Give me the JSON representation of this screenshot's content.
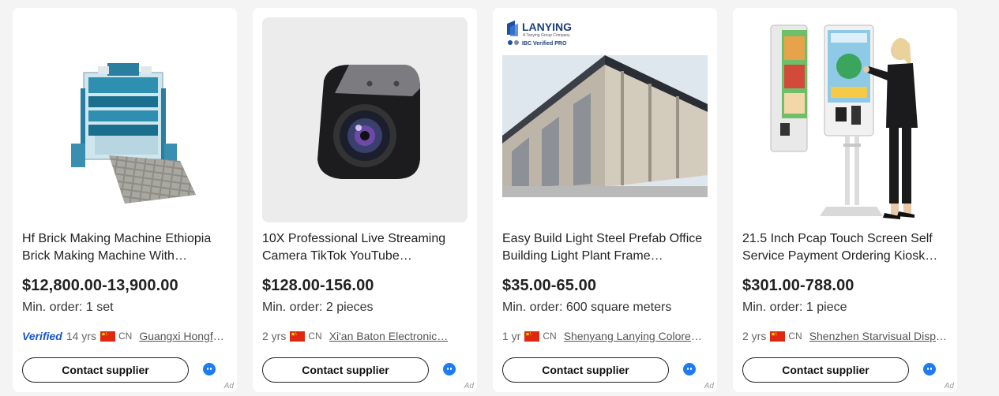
{
  "products": [
    {
      "image_name": "brick-making-machine-image",
      "title": "Hf Brick Making Machine Ethiopia Brick Making Machine With…",
      "price": "$12,800.00-13,900.00",
      "moq": "Min. order: 1 set",
      "verified": true,
      "verified_label": "Verified",
      "years": "14 yrs",
      "country": "CN",
      "supplier": "Guangxi Hongfa…",
      "contact_label": "Contact supplier",
      "ad_label": "Ad"
    },
    {
      "image_name": "streaming-camera-image",
      "title": "10X Professional Live Streaming Camera TikTok YouTube Facebook…",
      "price": "$128.00-156.00",
      "moq": "Min. order: 2 pieces",
      "verified": false,
      "years": "2 yrs",
      "country": "CN",
      "supplier": "Xi'an Baton Electronic…",
      "contact_label": "Contact supplier",
      "ad_label": "Ad"
    },
    {
      "image_name": "steel-prefab-building-image",
      "image_text": {
        "brand": "LANYING",
        "sub": "A Tanying Group Company",
        "badge": "IBC Verified PRO"
      },
      "title": "Easy Build Light Steel Prefab Office Building Light Plant Frame…",
      "price": "$35.00-65.00",
      "moq": "Min. order: 600 square meters",
      "verified": false,
      "years": "1 yr",
      "country": "CN",
      "supplier": "Shenyang Lanying Colored…",
      "contact_label": "Contact supplier",
      "ad_label": "Ad"
    },
    {
      "image_name": "payment-kiosk-image",
      "title": "21.5 Inch Pcap Touch Screen Self Service Payment Ordering Kiosk fo…",
      "price": "$301.00-788.00",
      "moq": "Min. order: 1 piece",
      "verified": false,
      "years": "2 yrs",
      "country": "CN",
      "supplier": "Shenzhen Starvisual Displa…",
      "contact_label": "Contact supplier",
      "ad_label": "Ad"
    }
  ],
  "colors": {
    "verified_blue": "#1a56c8",
    "chat_blue": "#1e7bf3",
    "cn_flag_red": "#de2910",
    "cn_flag_star": "#ffde00"
  },
  "icons": {
    "chat": "chat-bubble-icon",
    "flag": "cn-flag-icon"
  }
}
